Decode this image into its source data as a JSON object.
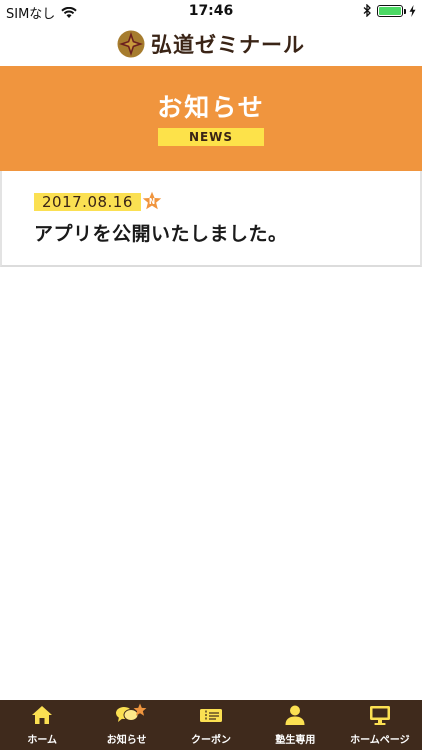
{
  "status_bar": {
    "carrier": "SIMなし",
    "time": "17:46",
    "battery_level": 1.0
  },
  "header": {
    "logo_text": "弘道ゼミナール"
  },
  "page": {
    "title": "お知らせ",
    "subtitle": "NEWS"
  },
  "news": [
    {
      "date": "2017.08.16",
      "badge": "N",
      "text": "アプリを公開いたしました。"
    }
  ],
  "tabs": [
    {
      "label": "ホーム",
      "icon": "home-icon"
    },
    {
      "label": "お知らせ",
      "icon": "chat-bubbles-icon",
      "badge": true
    },
    {
      "label": "クーポン",
      "icon": "coupon-ticket-icon"
    },
    {
      "label": "塾生専用",
      "icon": "person-icon"
    },
    {
      "label": "ホームページ",
      "icon": "monitor-icon"
    }
  ],
  "colors": {
    "brand_orange": "#f0953e",
    "accent_yellow": "#fbe052",
    "tab_background": "#3f2a1c",
    "logo_brown": "#3a2416"
  }
}
